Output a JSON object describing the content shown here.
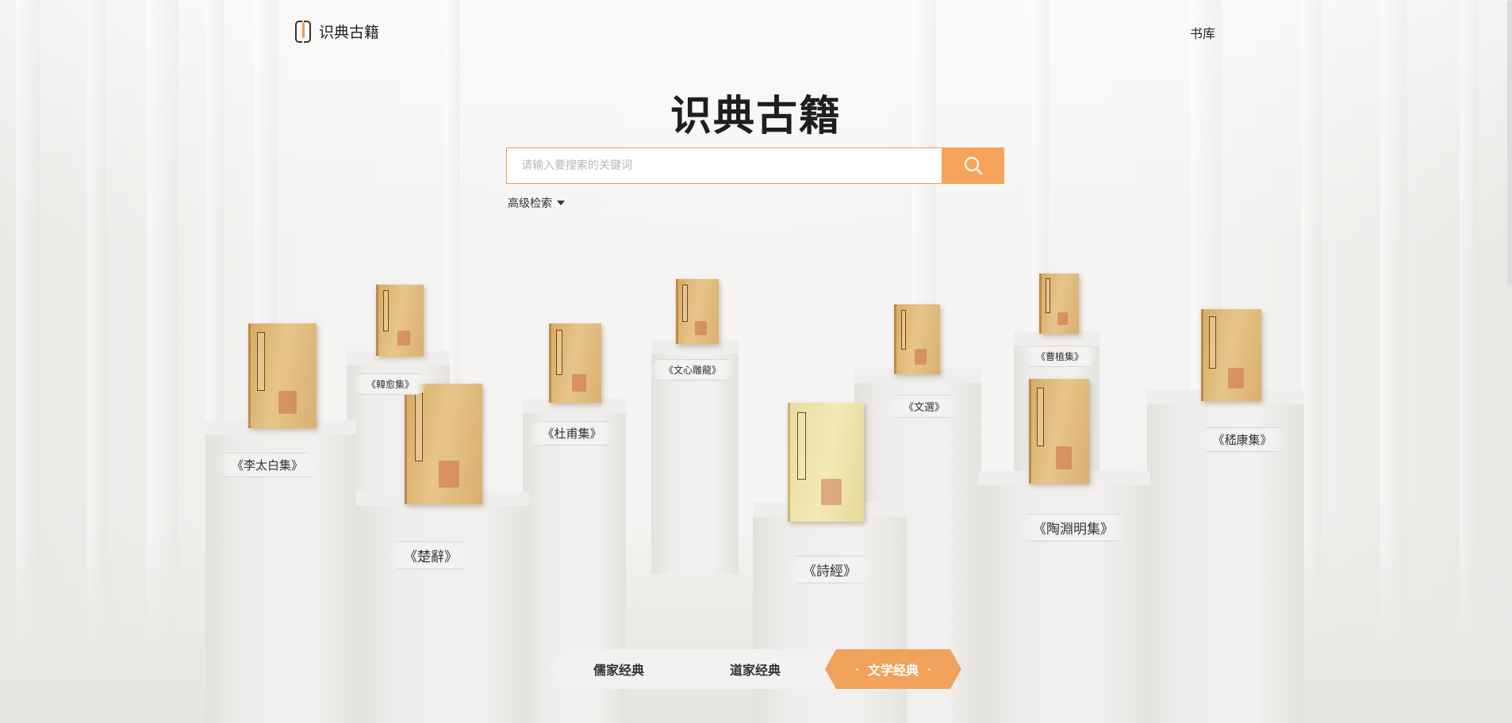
{
  "header": {
    "logo_text": "识典古籍",
    "nav_library": "书库"
  },
  "hero": {
    "title": "识典古籍",
    "search_placeholder": "请输入要搜索的关键词",
    "advanced_search": "高级检索"
  },
  "books": [
    {
      "label": "《李太白集》"
    },
    {
      "label": "《韓愈集》"
    },
    {
      "label": "《楚辭》"
    },
    {
      "label": "《杜甫集》"
    },
    {
      "label": "《文心雕龍》"
    },
    {
      "label": "《詩經》"
    },
    {
      "label": "《文選》"
    },
    {
      "label": "《曹植集》"
    },
    {
      "label": "《陶淵明集》"
    },
    {
      "label": "《嵇康集》"
    }
  ],
  "tabs": [
    {
      "label": "儒家经典",
      "active": false
    },
    {
      "label": "道家经典",
      "active": false
    },
    {
      "label": "文学经典",
      "active": true
    }
  ],
  "colors": {
    "accent": "#f5a35a",
    "active_tab": "#f0a15a",
    "text": "#222222"
  },
  "icons": {
    "search": "search-icon",
    "caret": "caret-down-icon"
  }
}
